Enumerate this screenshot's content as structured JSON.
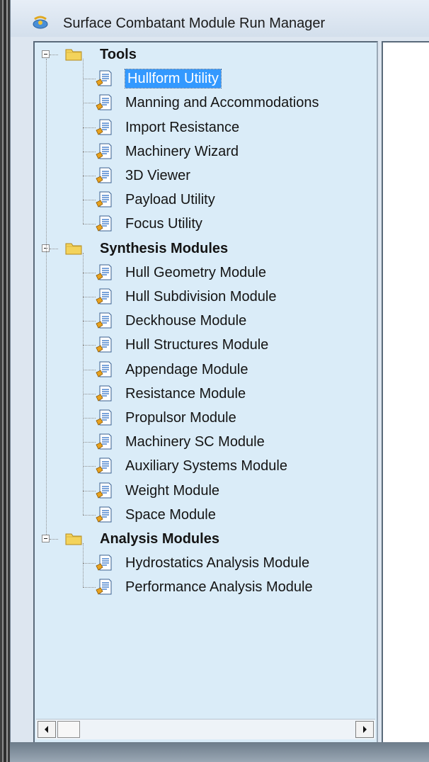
{
  "window": {
    "title": "Surface Combatant Module Run Manager"
  },
  "tree": {
    "groups": [
      {
        "label": "Tools",
        "items": [
          "Hullform Utility",
          "Manning and Accommodations",
          "Import Resistance",
          "Machinery Wizard",
          "3D Viewer",
          "Payload Utility",
          "Focus Utility"
        ]
      },
      {
        "label": "Synthesis Modules",
        "items": [
          "Hull Geometry Module",
          "Hull Subdivision Module",
          "Deckhouse Module",
          "Hull Structures Module",
          "Appendage Module",
          "Resistance Module",
          "Propulsor Module",
          "Machinery SC Module",
          "Auxiliary Systems Module",
          "Weight Module",
          "Space Module"
        ]
      },
      {
        "label": "Analysis Modules",
        "items": [
          "Hydrostatics Analysis Module",
          "Performance Analysis Module"
        ]
      }
    ],
    "selected": "Hullform Utility"
  },
  "icons": {
    "app": "satellite-icon",
    "group": "folder-icon",
    "item": "document-icon"
  },
  "colors": {
    "selection": "#3399ff",
    "tree_background": "#daecf8"
  }
}
